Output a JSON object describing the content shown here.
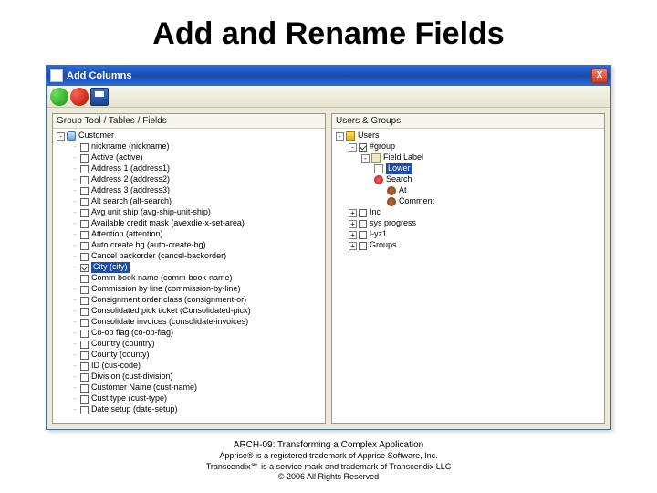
{
  "slide": {
    "title": "Add and Rename Fields"
  },
  "window": {
    "title": "Add Columns",
    "close": "X",
    "toolbar": {
      "accept": "accept",
      "cancel": "cancel",
      "save": "save"
    }
  },
  "left": {
    "header": "Group Tool / Tables / Fields",
    "root": "Customer",
    "fields": [
      {
        "label": "nickname (nickname)"
      },
      {
        "label": "Active (active)"
      },
      {
        "label": "Address 1 (address1)"
      },
      {
        "label": "Address 2 (address2)"
      },
      {
        "label": "Address 3 (address3)"
      },
      {
        "label": "Alt search (alt-search)"
      },
      {
        "label": "Avg unit ship (avg-ship-unit-ship)"
      },
      {
        "label": "Available credit mask (avexdie-x-set-area)"
      },
      {
        "label": "Attention (attention)"
      },
      {
        "label": "Auto create bg (auto-create-bg)"
      },
      {
        "label": "Cancel backorder (cancel-backorder)"
      },
      {
        "label": "City (city)",
        "checked": true,
        "highlight": true
      },
      {
        "label": "Comm book name (comm-book-name)"
      },
      {
        "label": "Commission by line (commission-by-line)"
      },
      {
        "label": "Consignment order class (consignment-or)"
      },
      {
        "label": "Consolidated pick ticket (Consolidated-pick)"
      },
      {
        "label": "Consolidate invoices (consolidate-invoices)"
      },
      {
        "label": "Co-op flag (co-op-flag)"
      },
      {
        "label": "Country (country)"
      },
      {
        "label": "County (county)"
      },
      {
        "label": "ID (cus-code)"
      },
      {
        "label": "Division (cust-division)"
      },
      {
        "label": "Customer Name (cust-name)"
      },
      {
        "label": "Cust type (cust-type)"
      },
      {
        "label": "Date setup (date-setup)"
      }
    ]
  },
  "right": {
    "header": "Users & Groups",
    "root": "Users",
    "groupNode": "#group",
    "fieldLabel": "Field Label",
    "selected": "Lower",
    "under": [
      {
        "label": "Search",
        "icon": "red"
      },
      {
        "label": "At",
        "indent": 1,
        "icon": "brown"
      },
      {
        "label": "Comment",
        "indent": 1,
        "icon": "brown"
      }
    ],
    "siblings": [
      {
        "label": "Inc"
      },
      {
        "label": "sys progress"
      },
      {
        "label": "l-yz1"
      },
      {
        "label": "Groups"
      }
    ]
  },
  "footer": {
    "l1": "ARCH-09: Transforming a Complex Application",
    "l2": "Apprise® is a registered trademark of Apprise Software, Inc.",
    "l3": "Transcendix℠ is a service mark and trademark of Transcendix LLC",
    "l4": "© 2006 All Rights Reserved"
  }
}
